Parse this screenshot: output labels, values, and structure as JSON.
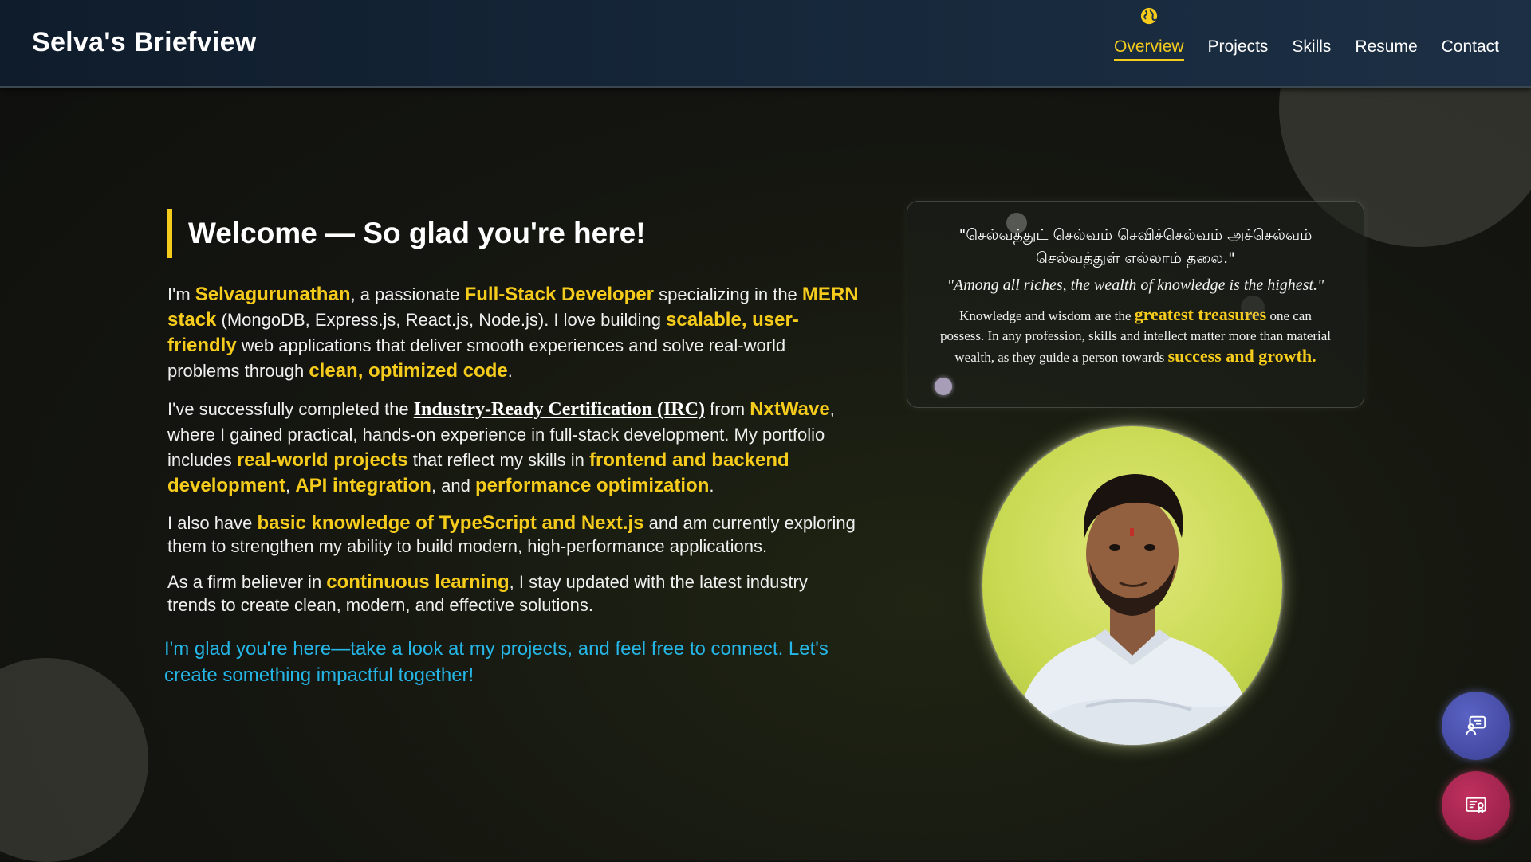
{
  "brand": "Selva's Briefview",
  "nav": {
    "items": [
      {
        "label": "Overview",
        "active": true
      },
      {
        "label": "Projects",
        "active": false
      },
      {
        "label": "Skills",
        "active": false
      },
      {
        "label": "Resume",
        "active": false
      },
      {
        "label": "Contact",
        "active": false
      }
    ],
    "active_icon": "globe-icon"
  },
  "welcome": {
    "title": "Welcome — So glad you're here!",
    "p1": {
      "t1": "I'm ",
      "name": "Selvagurunathan",
      "t2": ", a passionate ",
      "role": "Full-Stack Developer",
      "t3": " specializing in the ",
      "stack": "MERN stack",
      "t4": " (MongoDB, Express.js, React.js, Node.js). I love building ",
      "qualities": "scalable, user-friendly",
      "t5": " web applications that deliver smooth experiences and solve real-world problems through ",
      "code": "clean, optimized code",
      "t6": "."
    },
    "p2": {
      "t1": "I've successfully completed the ",
      "cert": "Industry-Ready Certification (IRC)",
      "t2": " from ",
      "org": "NxtWave",
      "t3": ", where I gained practical, hands-on experience in full-stack development. My portfolio includes ",
      "projects": "real-world projects",
      "t4": " that reflect my skills in ",
      "skills": "frontend and backend development",
      "t5": ", ",
      "api": "API integration",
      "t6": ", and ",
      "perf": "performance optimization",
      "t7": "."
    },
    "p3": {
      "t1": "I also have ",
      "ts": "basic knowledge of TypeScript and Next.js",
      "t2": " and am currently exploring them to strengthen my ability to build modern, high-performance applications."
    },
    "p4": {
      "t1": "As a firm believer in ",
      "learn": "continuous learning",
      "t2": ", I stay updated with the latest industry trends to create clean, modern, and effective solutions."
    },
    "cta": "I'm glad you're here—take a look at my projects, and feel free to connect. Let's create something impactful together!"
  },
  "quote": {
    "tamil": "\"செல்வத்துட் செல்வம் செவிச்செல்வம் அச்செல்வம் செல்வத்துள் எல்லாம் தலை.\"",
    "english": "\"Among all riches, the wealth of knowledge is the highest.\"",
    "desc": {
      "t1": "Knowledge and wisdom are the ",
      "hl1": "greatest treasures",
      "t2": " one can possess. In any profession, skills and intellect matter more than material wealth, as they guide a person towards ",
      "hl2": "success and growth."
    }
  },
  "profile": {
    "photo": "profile-photo"
  },
  "fabs": {
    "chat_icon": "chat-icon",
    "cert_icon": "certificate-icon"
  },
  "colors": {
    "accent": "#f6cc1c",
    "link": "#25b6e6",
    "chat_fab": "#4a50b0",
    "cert_fab": "#a8244f"
  }
}
